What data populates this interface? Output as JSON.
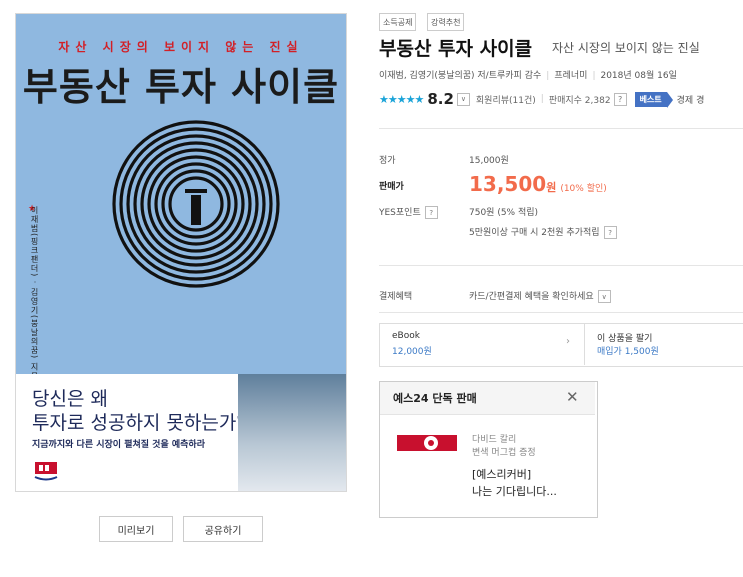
{
  "cover": {
    "tagline": "자산 시장의 보이지 않는 진실",
    "title": "부동산 투자 사이클",
    "authors": "이재범(핑크팬더) · 김영기(붕날의꿈) 지음 · 트루카피 감수",
    "hook_line1": "당신은 왜",
    "hook_line2": "투자로 성공하지 못하는가?",
    "subline": "지금까지와 다른 시장이 펼쳐질 것을 예측하라"
  },
  "actions": {
    "preview": "미리보기",
    "share": "공유하기"
  },
  "tags": [
    "소득공제",
    "강력추천"
  ],
  "book": {
    "title": "부동산 투자 사이클",
    "subtitle": "자산 시장의 보이지 않는 진실",
    "authors": "이재범, 김영기(붕날의꿈) 저/트루카피 감수",
    "publisher": "프레너미",
    "date": "2018년 08월 16일"
  },
  "rating": {
    "stars_text": "★★★★★",
    "score": "8.2",
    "reviews": "회원리뷰(11건)",
    "sales_index": "판매지수 2,382",
    "best_badge": "베스트",
    "best_text": "경제 경"
  },
  "price": {
    "list_label": "정가",
    "list_value": "15,000원",
    "sale_label": "판매가",
    "sale_value": "13,500",
    "sale_unit": "원",
    "discount": "(10% 할인)",
    "points_label": "YES포인트",
    "points_value": "750원 (5% 적립)",
    "points_extra": "5만원이상 구매 시 2천원 추가적립"
  },
  "payment": {
    "label": "결제혜택",
    "value": "카드/간편결제 혜택을 확인하세요"
  },
  "ebook": {
    "label": "eBook",
    "price": "12,000원",
    "sell_label": "이 상품을 팔기",
    "sell_price": "매입가 1,500원"
  },
  "promo": {
    "title": "예스24 단독 판매",
    "item_name_line1": "다비드 칼리",
    "item_name_line2": "변색 머그컵 증정",
    "link_line1": "[예스리커버]",
    "link_line2": "나는 기다립니다..."
  },
  "colors": {
    "accent_red": "#f26b4b",
    "link_blue": "#3c7ac6",
    "star_blue": "#1aa3d8",
    "best_blue": "#4472c4",
    "cover_blue": "#8fb8e0"
  }
}
